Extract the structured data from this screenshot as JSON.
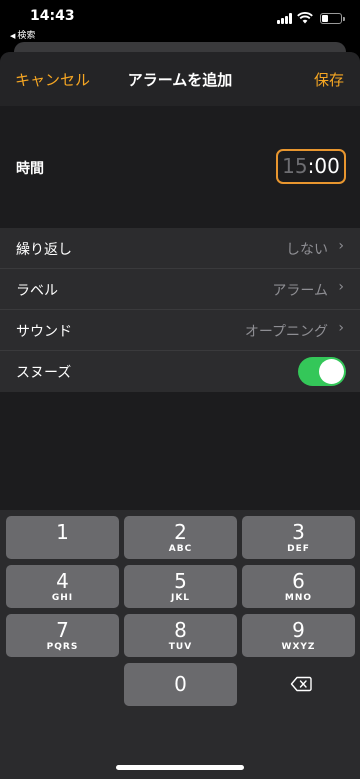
{
  "status": {
    "time": "14:43",
    "back_app": "検索"
  },
  "navbar": {
    "cancel": "キャンセル",
    "title": "アラームを追加",
    "save": "保存"
  },
  "time": {
    "label": "時間",
    "hours": "15",
    "colon": ":",
    "minutes": "00"
  },
  "settings": [
    {
      "label": "繰り返し",
      "value": "しない"
    },
    {
      "label": "ラベル",
      "value": "アラーム"
    },
    {
      "label": "サウンド",
      "value": "オープニング"
    },
    {
      "label": "スヌーズ",
      "toggle_on": true
    }
  ],
  "keypad": {
    "keys": [
      {
        "num": "1",
        "letters": ""
      },
      {
        "num": "2",
        "letters": "ABC"
      },
      {
        "num": "3",
        "letters": "DEF"
      },
      {
        "num": "4",
        "letters": "GHI"
      },
      {
        "num": "5",
        "letters": "JKL"
      },
      {
        "num": "6",
        "letters": "MNO"
      },
      {
        "num": "7",
        "letters": "PQRS"
      },
      {
        "num": "8",
        "letters": "TUV"
      },
      {
        "num": "9",
        "letters": "WXYZ"
      },
      {
        "num": "0",
        "letters": ""
      }
    ]
  },
  "colors": {
    "accent": "#f5a623",
    "toggle": "#34c759",
    "focus_border": "#e8962f"
  },
  "icons": {
    "delete": "delete-backspace-icon",
    "chevron": "chevron-right-icon"
  }
}
